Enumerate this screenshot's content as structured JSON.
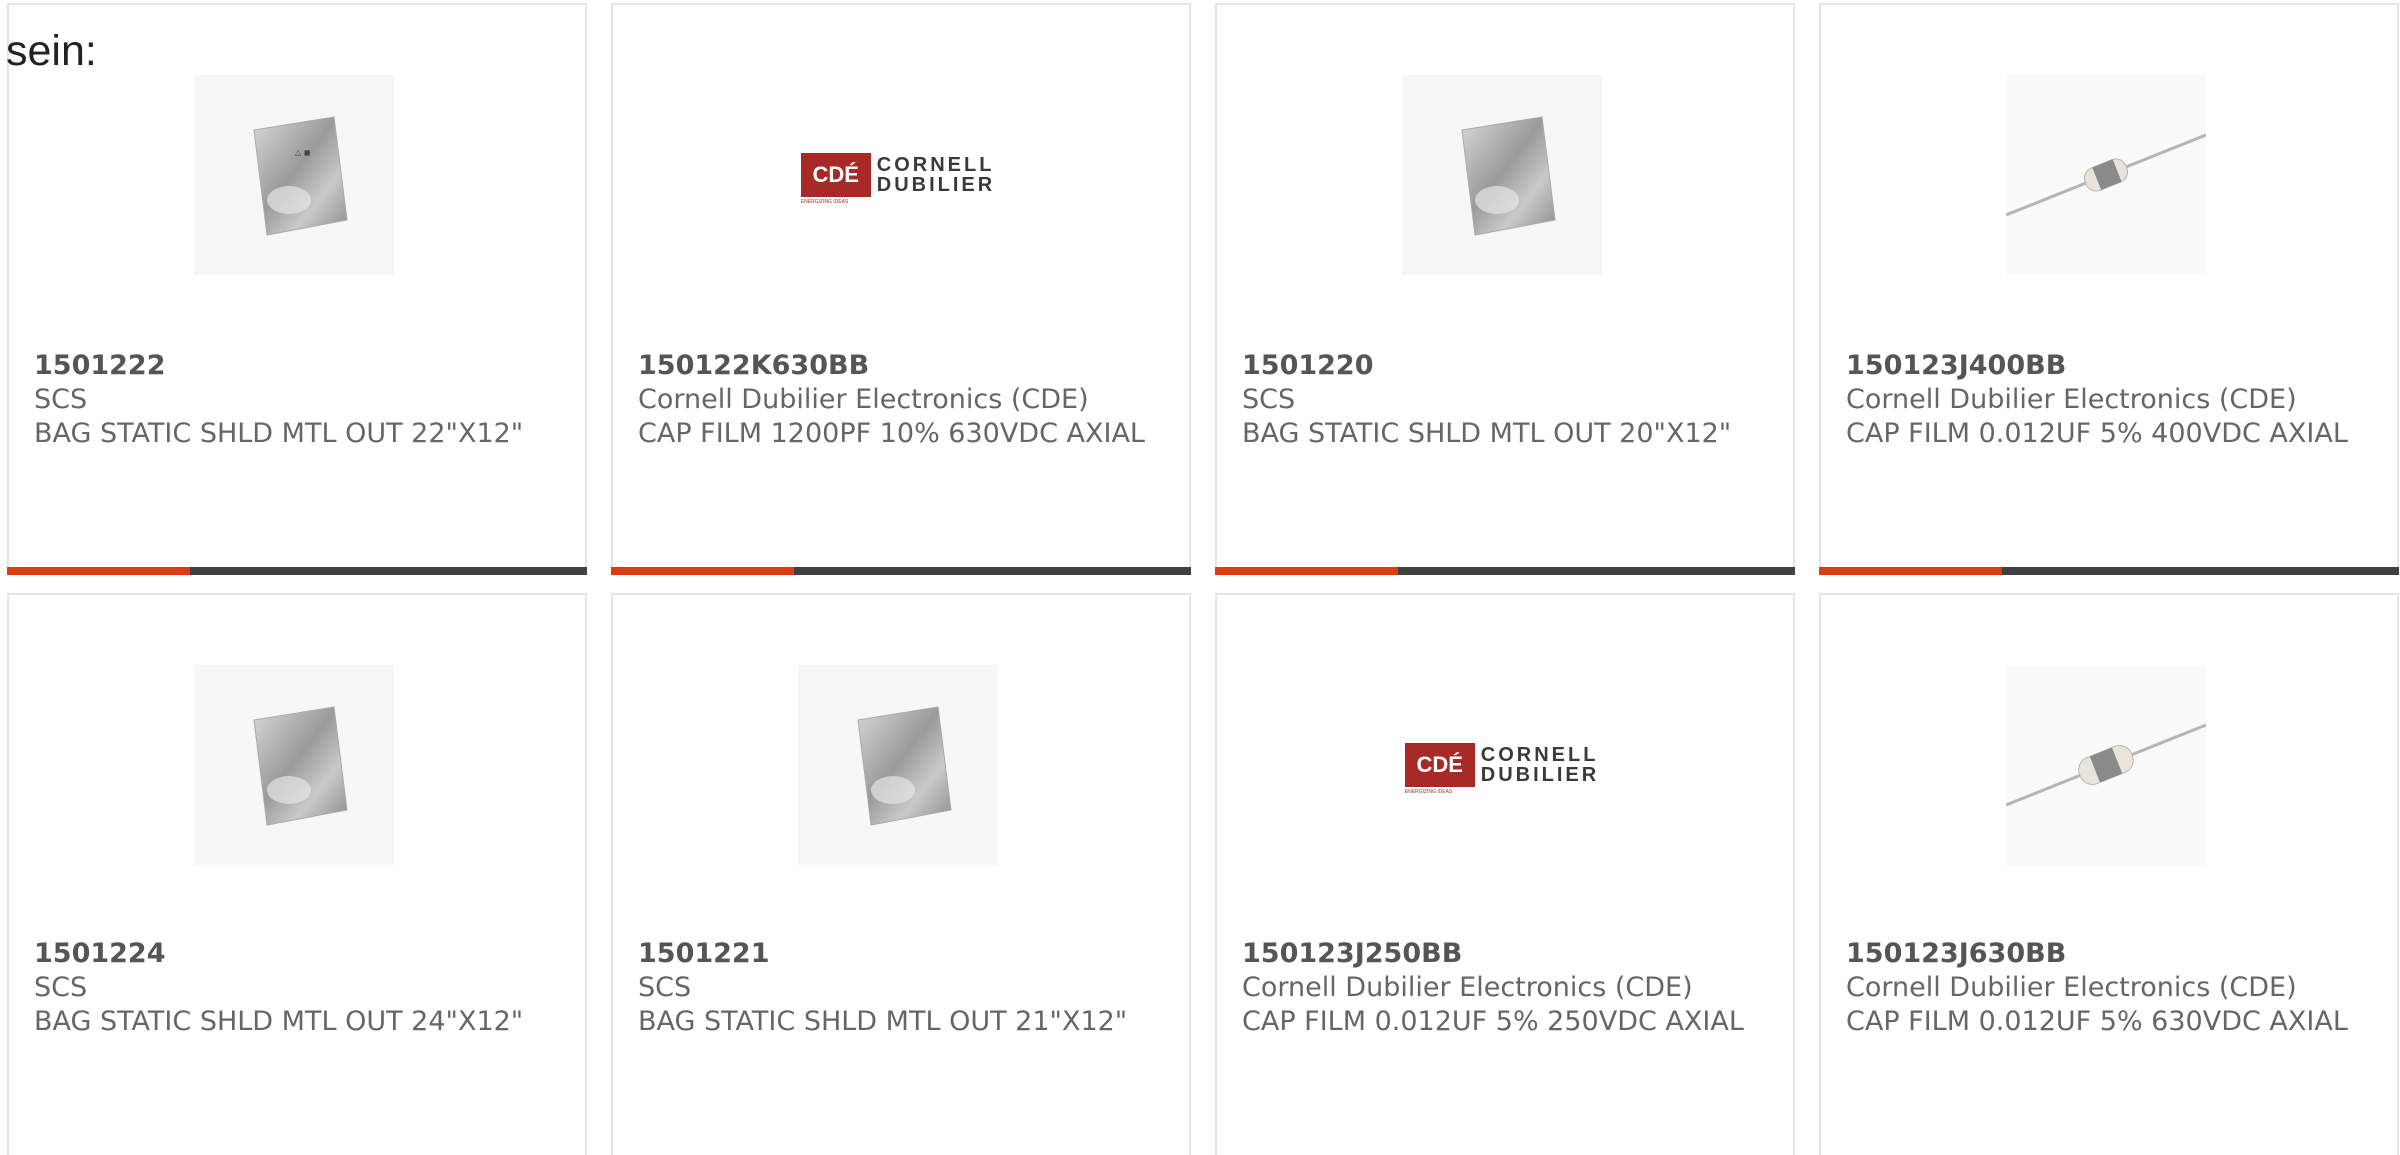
{
  "intro_text": "sein:",
  "products": [
    {
      "part": "1501222",
      "manufacturer": "SCS",
      "description": "BAG STATIC SHLD MTL OUT 22\"X12\"",
      "image": "static-bag-icon"
    },
    {
      "part": "150122K630BB",
      "manufacturer": "Cornell Dubilier Electronics (CDE)",
      "description": "CAP FILM 1200PF 10% 630VDC AXIAL",
      "image": "cde-logo"
    },
    {
      "part": "1501220",
      "manufacturer": "SCS",
      "description": "BAG STATIC SHLD MTL OUT 20\"X12\"",
      "image": "static-bag-icon"
    },
    {
      "part": "150123J400BB",
      "manufacturer": "Cornell Dubilier Electronics (CDE)",
      "description": "CAP FILM 0.012UF 5% 400VDC AXIAL",
      "image": "axial-capacitor-icon"
    },
    {
      "part": "1501224",
      "manufacturer": "SCS",
      "description": "BAG STATIC SHLD MTL OUT 24\"X12\"",
      "image": "static-bag-icon"
    },
    {
      "part": "1501221",
      "manufacturer": "SCS",
      "description": "BAG STATIC SHLD MTL OUT 21\"X12\"",
      "image": "static-bag-icon"
    },
    {
      "part": "150123J250BB",
      "manufacturer": "Cornell Dubilier Electronics (CDE)",
      "description": "CAP FILM 0.012UF 5% 250VDC AXIAL",
      "image": "cde-logo"
    },
    {
      "part": "150123J630BB",
      "manufacturer": "Cornell Dubilier Electronics (CDE)",
      "description": "CAP FILM 0.012UF 5% 630VDC AXIAL",
      "image": "axial-capacitor-icon"
    }
  ],
  "cde_logo": {
    "mark": "CDÉ",
    "tagline": "ENERGIZING IDEAS",
    "line1": "CORNELL",
    "line2": "DUBILIER"
  },
  "colors": {
    "accent": "#e03a10",
    "bar": "#404040",
    "card_border": "#e5e5e5",
    "text": "#666666",
    "cde_red": "#a82a26"
  }
}
